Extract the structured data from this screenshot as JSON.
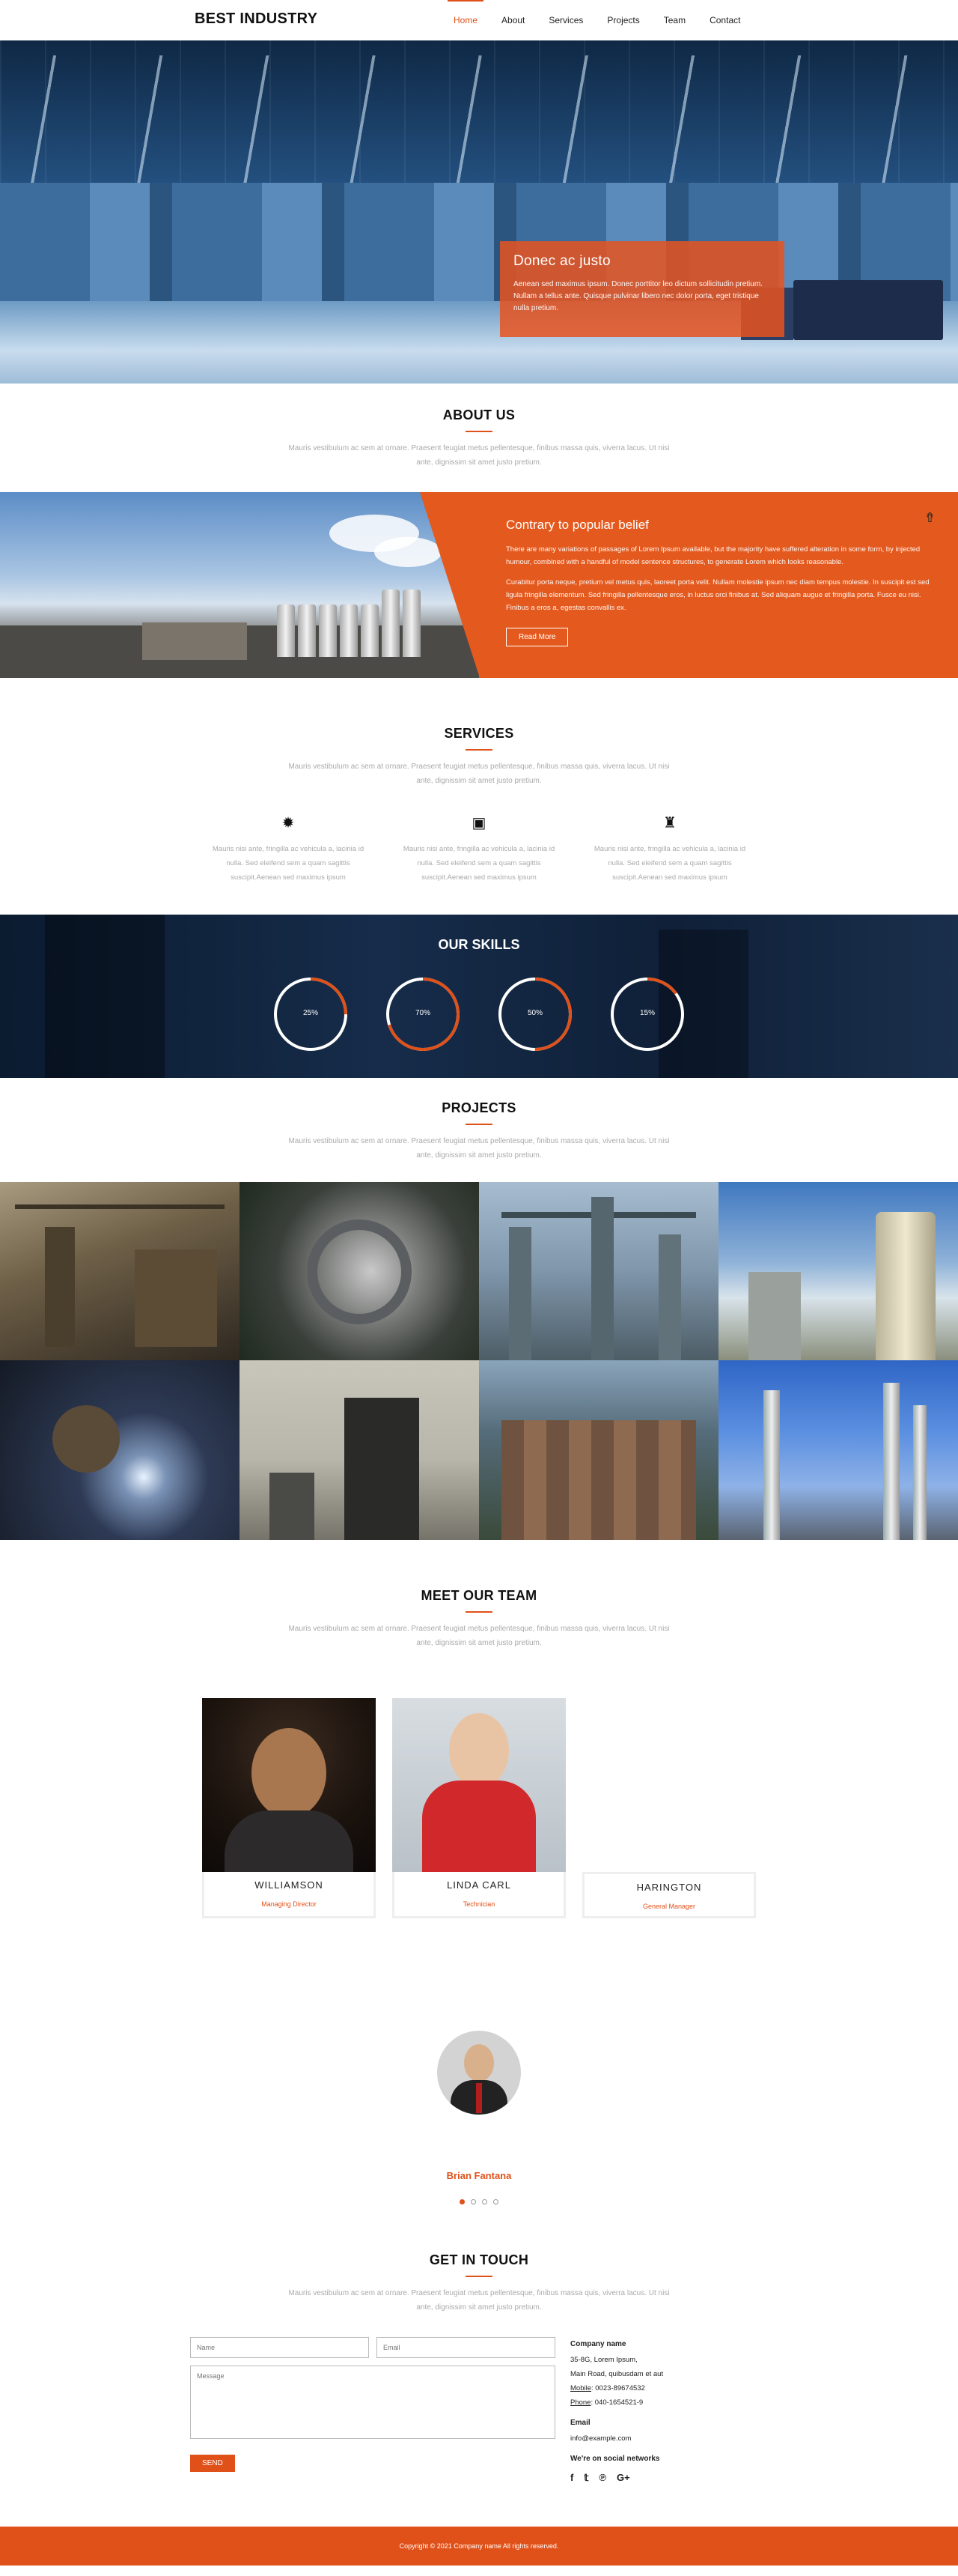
{
  "nav": {
    "brand": "BEST INDUSTRY",
    "items": [
      "Home",
      "About",
      "Services",
      "Projects",
      "Team",
      "Contact"
    ],
    "active": "Home"
  },
  "hero": {
    "title": "Donec ac justo",
    "text": "Aenean sed maximus ipsum. Donec porttitor leo dictum sollicitudin pretium. Nullam a tellus ante. Quisque pulvinar libero nec dolor porta, eget tristique nulla pretium."
  },
  "about": {
    "heading": "ABOUT US",
    "intro": "Mauris vestibulum ac sem at ornare. Praesent feugiat metus pellentesque, finibus massa quis, viverra lacus. Ut nisi ante, dignissim sit amet justo pretium.",
    "title": "Contrary to popular belief",
    "para1": "There are many variations of passages of Lorem Ipsum available, but the majority have suffered alteration in some form, by injected humour, combined with a handful of model sentence structures, to generate Lorem which looks reasonable.",
    "para2": "Curabitur porta neque, pretium vel metus quis, laoreet porta velit. Nullam molestie ipsum nec diam tempus molestie. In suscipit est sed ligula fringilla elementum. Sed fringilla pellentesque eros, in luctus orci finibus at. Sed aliquam augue et fringilla porta. Fusce eu nisi. Finibus a eros a, egestas convallis ex.",
    "button": "Read More"
  },
  "services": {
    "heading": "SERVICES",
    "intro": "Mauris vestibulum ac sem at ornare. Praesent feugiat metus pellentesque, finibus massa quis, viverra lacus. Ut nisi ante, dignissim sit amet justo pretium.",
    "items": [
      {
        "icon": "gear-icon",
        "glyph": "✹",
        "text": "Mauris nisi ante, fringilla ac vehicula a, lacinia id nulla. Sed eleifend sem a quam sagittis suscipit.Aenean sed maximus ipsum"
      },
      {
        "icon": "inbox-icon",
        "glyph": "▣",
        "text": "Mauris nisi ante, fringilla ac vehicula a, lacinia id nulla. Sed eleifend sem a quam sagittis suscipit.Aenean sed maximus ipsum"
      },
      {
        "icon": "chess-rook-icon",
        "glyph": "♜",
        "text": "Mauris nisi ante, fringilla ac vehicula a, lacinia id nulla. Sed eleifend sem a quam sagittis suscipit.Aenean sed maximus ipsum"
      }
    ]
  },
  "skills": {
    "heading": "OUR SKILLS",
    "items": [
      {
        "label": "25%",
        "value": 0.25
      },
      {
        "label": "70%",
        "value": 0.7
      },
      {
        "label": "50%",
        "value": 0.5
      },
      {
        "label": "15%",
        "value": 0.15
      }
    ]
  },
  "projects": {
    "heading": "PROJECTS",
    "intro": "Mauris vestibulum ac sem at ornare. Praesent feugiat metus pellentesque, finibus massa quis, viverra lacus. Ut nisi ante, dignissim sit amet justo pretium."
  },
  "team": {
    "heading": "MEET OUR TEAM",
    "intro": "Mauris vestibulum ac sem at ornare. Praesent feugiat metus pellentesque, finibus massa quis, viverra lacus. Ut nisi ante, dignissim sit amet justo pretium.",
    "members": [
      {
        "name": "WILLIAMSON",
        "role": "Managing Director"
      },
      {
        "name": "LINDA CARL",
        "role": "Technician"
      },
      {
        "name": "HARINGTON",
        "role": "General Manager"
      }
    ]
  },
  "testimonial": {
    "name": "Brian Fantana"
  },
  "contact": {
    "heading": "GET IN TOUCH",
    "intro": "Mauris vestibulum ac sem at ornare. Praesent feugiat metus pellentesque, finibus massa quis, viverra lacus. Ut nisi ante, dignissim sit amet justo pretium.",
    "name_placeholder": "Name",
    "email_placeholder": "Email",
    "message_placeholder": "Message",
    "send": "SEND",
    "company_title": "Company name",
    "address1": "35-8G, Lorem Ipsum,",
    "address2": "Main Road, quibusdam et aut",
    "mobile_label": "Mobile",
    "mobile": ": 0023-89674532",
    "phone_label": "Phone",
    "phone": ": 040-1654521-9",
    "email_title": "Email",
    "email": "info@example.com",
    "social_title": "We're on social networks"
  },
  "footer": {
    "copyright": "Copyright © 2021 Company name All rights reserved."
  },
  "colors": {
    "accent": "#e0511a"
  }
}
